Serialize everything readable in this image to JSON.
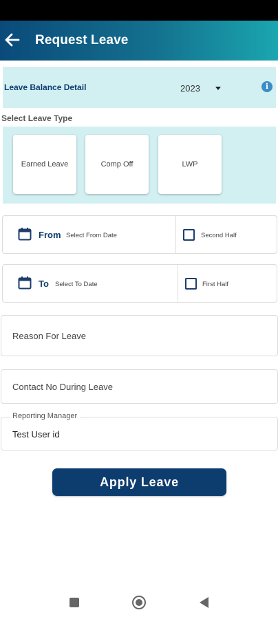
{
  "app_bar": {
    "title": "Request Leave",
    "back_icon": "arrow-left-icon"
  },
  "balance": {
    "label": "Leave Balance Detail",
    "year": "2023",
    "info_icon": "info-icon"
  },
  "leave_types": {
    "heading": "Select Leave Type",
    "items": [
      "Earned Leave",
      "Comp Off",
      "LWP"
    ]
  },
  "from_row": {
    "label": "From",
    "placeholder": "Select From Date",
    "checkbox_label": "Second Half",
    "checked": false
  },
  "to_row": {
    "label": "To",
    "placeholder": "Select To Date",
    "checkbox_label": "First Half",
    "checked": false
  },
  "reason": {
    "placeholder": "Reason For Leave"
  },
  "contact": {
    "placeholder": "Contact No During Leave"
  },
  "reporting_manager": {
    "label": "Reporting Manager",
    "value": "Test User  id"
  },
  "apply_button": "Apply Leave",
  "colors": {
    "primary": "#0d3d6e",
    "panel": "#d2f0f2",
    "appbar_start": "#0a4a7a",
    "appbar_end": "#1aa6b0"
  },
  "system_nav": [
    "recent-apps-icon",
    "home-icon",
    "back-icon"
  ]
}
